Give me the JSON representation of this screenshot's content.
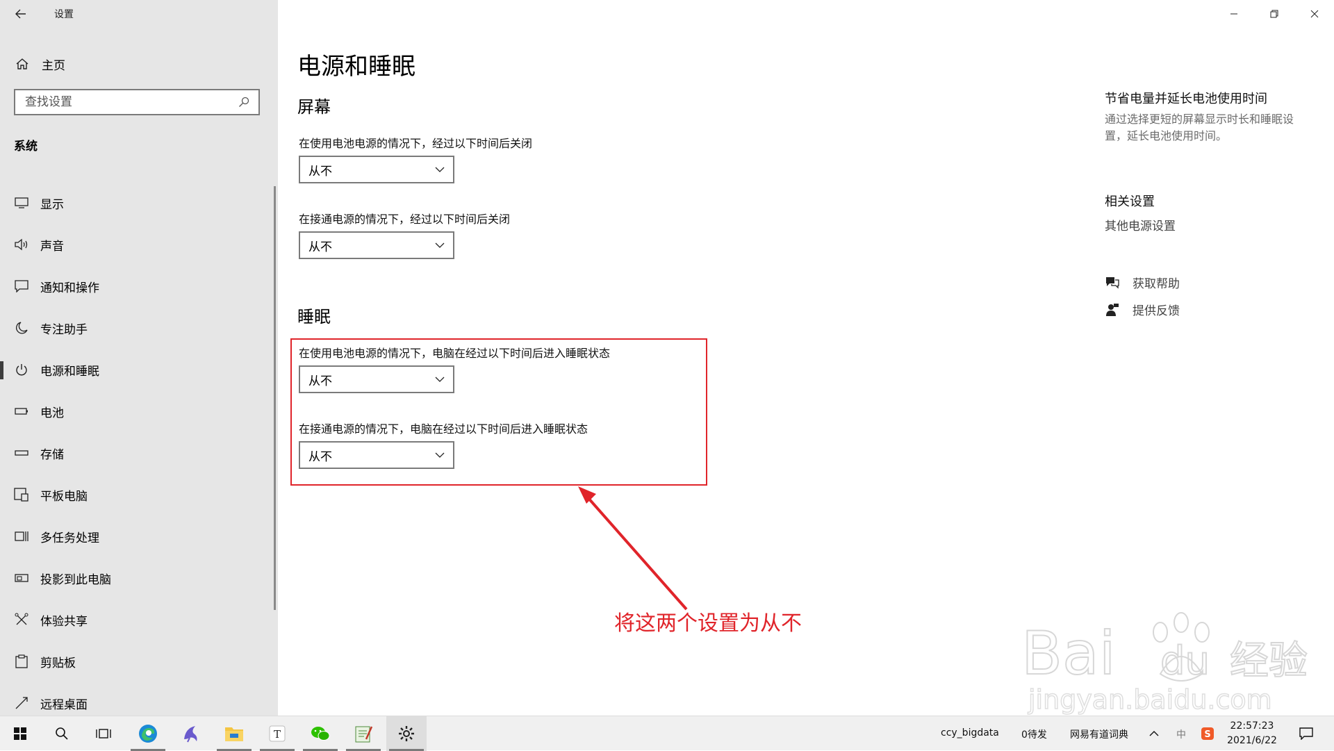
{
  "window": {
    "title": "设置"
  },
  "sidebar": {
    "home_label": "主页",
    "search_placeholder": "查找设置",
    "section_label": "系统",
    "items": [
      {
        "label": "显示",
        "icon": "monitor-icon"
      },
      {
        "label": "声音",
        "icon": "speaker-icon"
      },
      {
        "label": "通知和操作",
        "icon": "notification-icon"
      },
      {
        "label": "专注助手",
        "icon": "moon-icon"
      },
      {
        "label": "电源和睡眠",
        "icon": "power-icon",
        "active": true
      },
      {
        "label": "电池",
        "icon": "battery-icon"
      },
      {
        "label": "存储",
        "icon": "storage-icon"
      },
      {
        "label": "平板电脑",
        "icon": "tablet-icon"
      },
      {
        "label": "多任务处理",
        "icon": "multitask-icon"
      },
      {
        "label": "投影到此电脑",
        "icon": "project-icon"
      },
      {
        "label": "体验共享",
        "icon": "share-icon"
      },
      {
        "label": "剪贴板",
        "icon": "clipboard-icon"
      },
      {
        "label": "远程桌面",
        "icon": "remote-desktop-icon"
      }
    ]
  },
  "main": {
    "page_title": "电源和睡眠",
    "screen": {
      "title": "屏幕",
      "battery_label": "在使用电池电源的情况下，经过以下时间后关闭",
      "battery_value": "从不",
      "plugged_label": "在接通电源的情况下，经过以下时间后关闭",
      "plugged_value": "从不"
    },
    "sleep": {
      "title": "睡眠",
      "battery_label": "在使用电池电源的情况下，电脑在经过以下时间后进入睡眠状态",
      "battery_value": "从不",
      "plugged_label": "在接通电源的情况下，电脑在经过以下时间后进入睡眠状态",
      "plugged_value": "从不"
    }
  },
  "right_panel": {
    "tip_title": "节省电量并延长电池使用时间",
    "tip_text": "通过选择更短的屏幕显示时长和睡眠设置，延长电池使用时间。",
    "related_title": "相关设置",
    "related_link": "其他电源设置",
    "help_label": "获取帮助",
    "feedback_label": "提供反馈"
  },
  "annotation": {
    "text": "将这两个设置为从不",
    "color": "#e0242a"
  },
  "watermark": {
    "brand": "Baidu经验",
    "url": "jingyan.baidu.com"
  },
  "taskbar": {
    "apps": [
      "start-icon",
      "search-icon",
      "task-view-icon",
      "edge-icon",
      "dolphin-app-icon",
      "file-explorer-icon",
      "typora-icon",
      "wechat-icon",
      "notepad-icon",
      "settings-icon"
    ],
    "tray": {
      "user": "ccy_bigdata",
      "pending": "0待发",
      "dict": "网易有道词典",
      "ime": "中",
      "time": "22:57:23",
      "date": "2021/6/22"
    }
  }
}
